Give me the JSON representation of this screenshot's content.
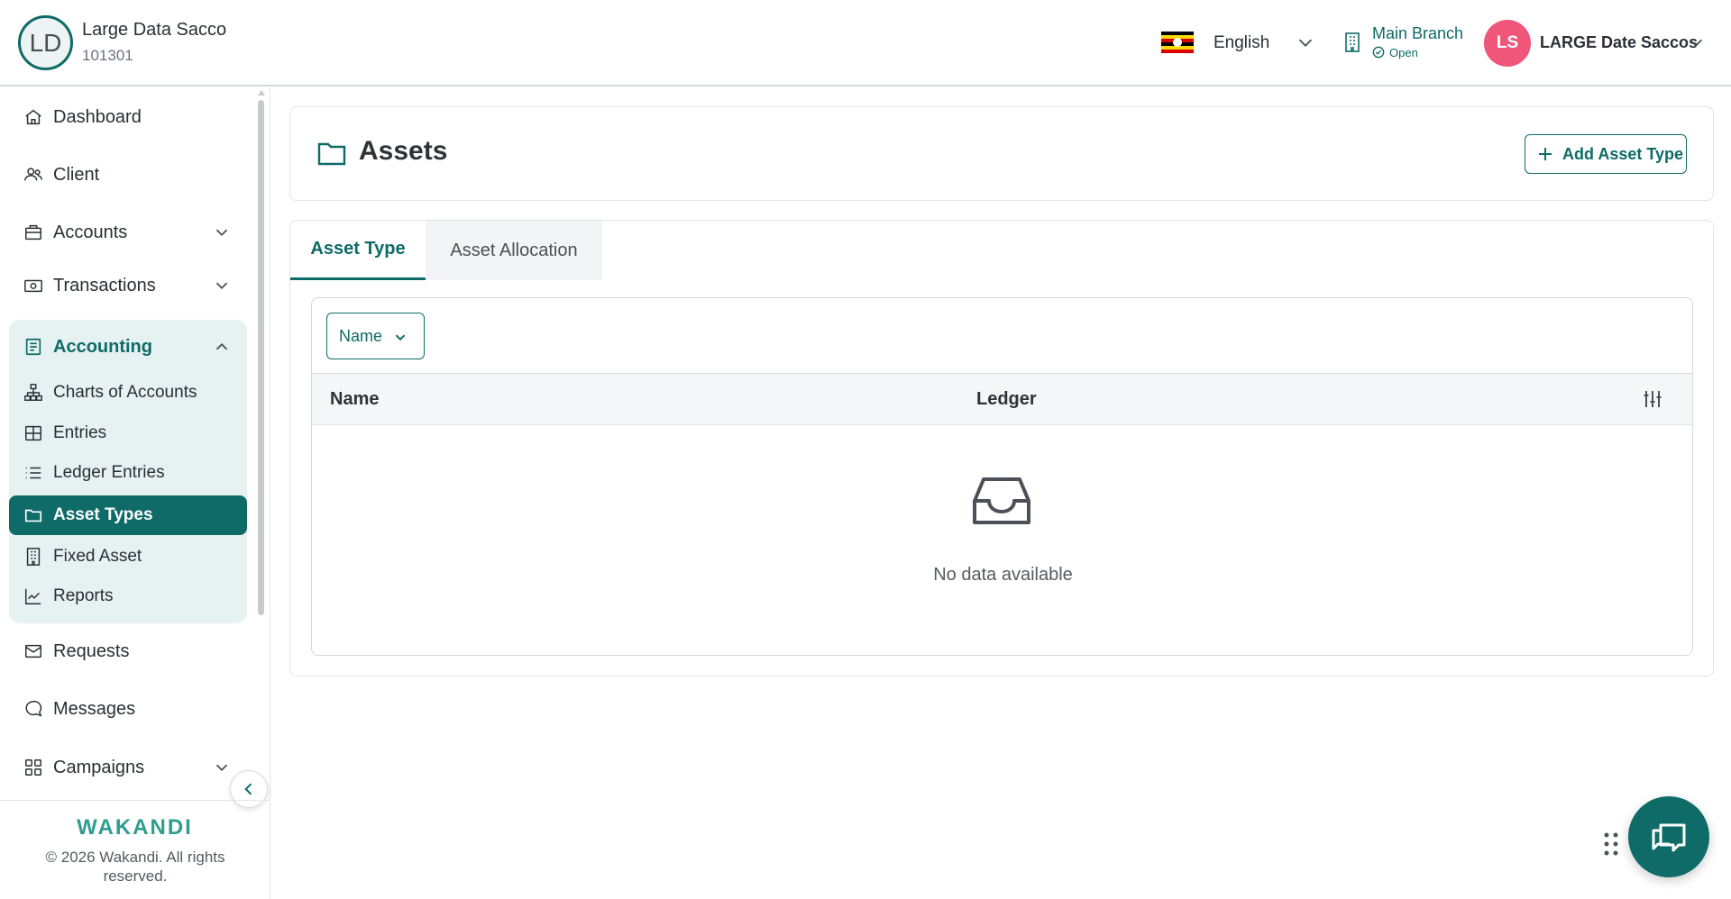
{
  "organization": {
    "avatar_initials": "LD",
    "name": "Large Data Sacco",
    "code": "101301"
  },
  "header": {
    "language": {
      "flag_icon": "uganda-flag-icon",
      "label": "English"
    },
    "branch": {
      "name": "Main Branch",
      "status": "Open"
    },
    "user": {
      "initials": "LS",
      "name": "LARGE Date Saccos",
      "avatar_color": "#f0567a"
    }
  },
  "sidebar": {
    "items": [
      {
        "label": "Dashboard",
        "icon": "home-icon"
      },
      {
        "label": "Client",
        "icon": "users-icon"
      },
      {
        "label": "Accounts",
        "icon": "briefcase-icon",
        "expandable": true
      },
      {
        "label": "Transactions",
        "icon": "cash-icon",
        "expandable": true
      },
      {
        "label": "Accounting",
        "icon": "ledger-book-icon",
        "expanded": true
      },
      {
        "label": "Requests",
        "icon": "mail-icon"
      },
      {
        "label": "Messages",
        "icon": "chat-bubble-icon"
      },
      {
        "label": "Campaigns",
        "icon": "grid-icon",
        "expandable": true
      }
    ],
    "accounting_children": [
      {
        "label": "Charts of Accounts",
        "icon": "hierarchy-icon"
      },
      {
        "label": "Entries",
        "icon": "table-icon"
      },
      {
        "label": "Ledger Entries",
        "icon": "list-icon"
      },
      {
        "label": "Asset Types",
        "icon": "folder-icon",
        "active": true
      },
      {
        "label": "Fixed Asset",
        "icon": "building-icon"
      },
      {
        "label": "Reports",
        "icon": "line-chart-icon"
      }
    ],
    "footer": {
      "brand": "WAKANDI",
      "copyright": "© 2026 Wakandi. All rights reserved."
    }
  },
  "page": {
    "title": "Assets",
    "title_icon": "folder-icon",
    "add_button_label": "Add Asset Type",
    "tabs": [
      {
        "label": "Asset Type",
        "active": true
      },
      {
        "label": "Asset Allocation",
        "active": false
      }
    ],
    "filter": {
      "label": "Name"
    },
    "table": {
      "columns": [
        "Name",
        "Ledger"
      ],
      "rows": [],
      "empty_text": "No data available"
    }
  },
  "colors": {
    "accent": "#0e6b67",
    "accent_light": "#e6f1f1",
    "brand": "#2f9d8f"
  }
}
